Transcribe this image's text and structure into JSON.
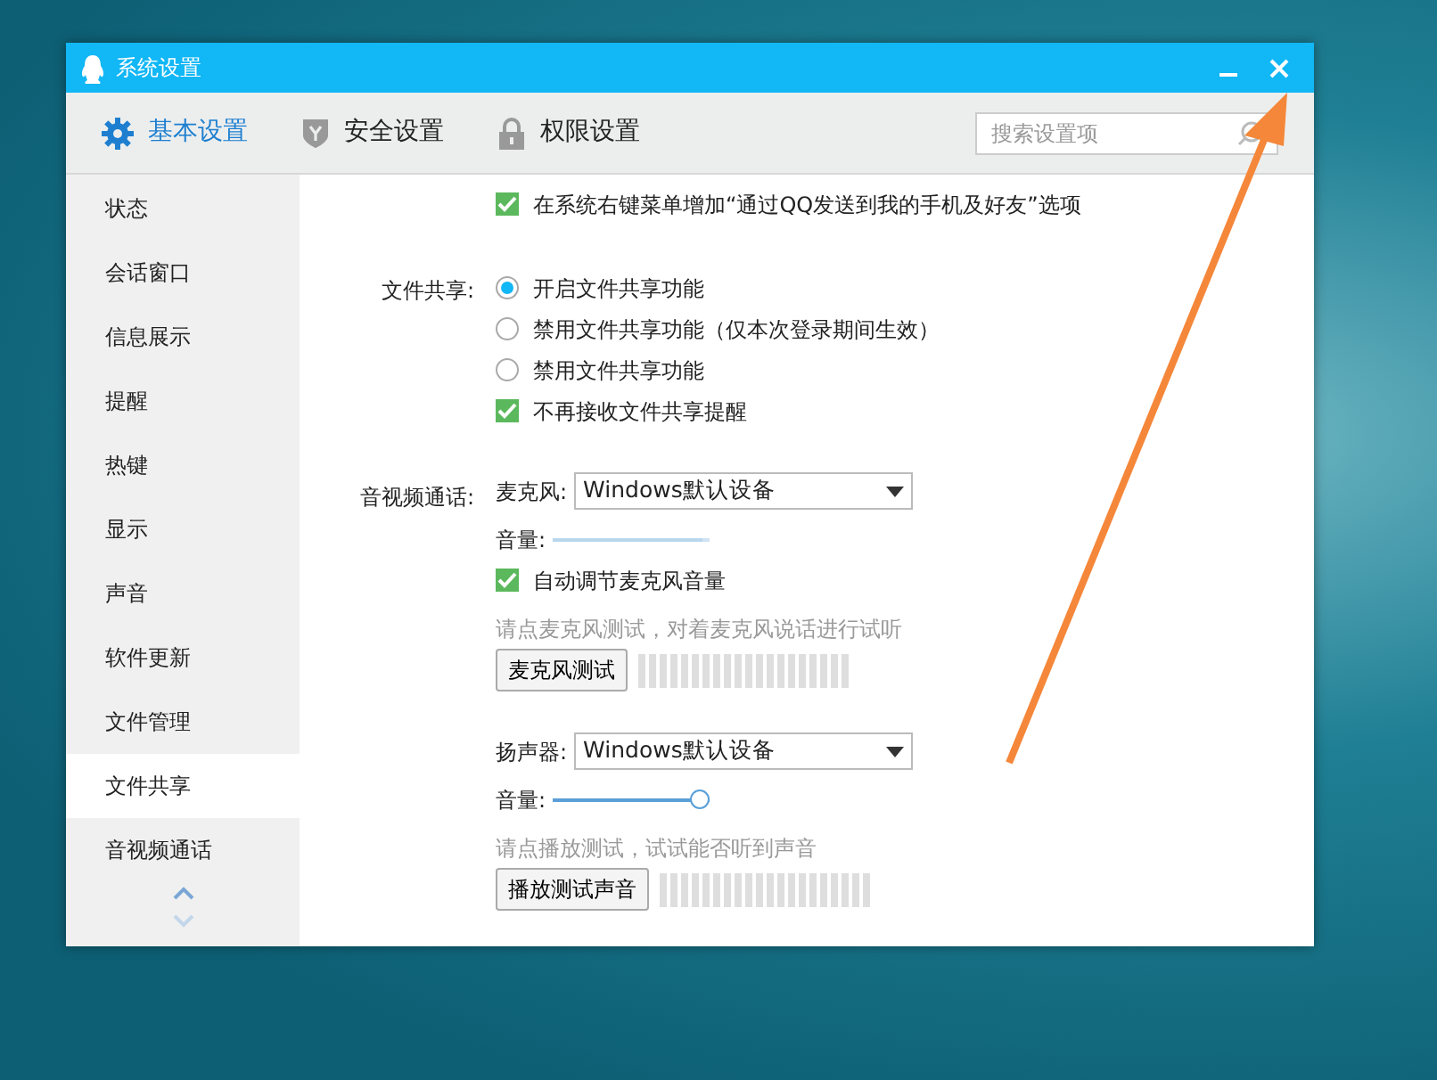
{
  "window": {
    "title": "系统设置"
  },
  "tabs": [
    {
      "label": "基本设置",
      "selected": true
    },
    {
      "label": "安全设置",
      "selected": false
    },
    {
      "label": "权限设置",
      "selected": false
    }
  ],
  "search": {
    "placeholder": "搜索设置项"
  },
  "sidebar": {
    "items": [
      {
        "label": "状态",
        "selected": false
      },
      {
        "label": "会话窗口",
        "selected": false
      },
      {
        "label": "信息展示",
        "selected": false
      },
      {
        "label": "提醒",
        "selected": false
      },
      {
        "label": "热键",
        "selected": false
      },
      {
        "label": "显示",
        "selected": false
      },
      {
        "label": "声音",
        "selected": false
      },
      {
        "label": "软件更新",
        "selected": false
      },
      {
        "label": "文件管理",
        "selected": false
      },
      {
        "label": "文件共享",
        "selected": true
      },
      {
        "label": "音视频通话",
        "selected": false
      }
    ]
  },
  "sections": [
    {
      "items": [
        {
          "kind": "checkbox",
          "label": "在系统右键菜单增加“通过QQ发送到我的手机及好友”选项",
          "checked": true
        }
      ]
    },
    {
      "label": "文件共享:",
      "items": [
        {
          "kind": "radio",
          "label": "开启文件共享功能",
          "selected": true
        },
        {
          "kind": "radio",
          "label": "禁用文件共享功能（仅本次登录期间生效）",
          "selected": false
        },
        {
          "kind": "radio",
          "label": "禁用文件共享功能",
          "selected": false
        },
        {
          "kind": "checkbox",
          "label": "不再接收文件共享提醒",
          "checked": true
        }
      ]
    },
    {
      "label": "音视频通话:",
      "items": [
        {
          "kind": "device",
          "label": "麦克风:",
          "value": "Windows默认设备"
        },
        {
          "kind": "slider",
          "label": "音量:",
          "level": 0.95,
          "disabled": true
        },
        {
          "kind": "checkbox",
          "label": "自动调节麦克风音量",
          "checked": true
        },
        {
          "kind": "hint",
          "text": "请点麦克风测试，对着麦克风说话进行试听"
        },
        {
          "kind": "test",
          "button": "麦克风测试"
        }
      ]
    },
    {
      "items": [
        {
          "kind": "device",
          "label": "扬声器:",
          "value": "Windows默认设备"
        },
        {
          "kind": "slider",
          "label": "音量:",
          "level": 1,
          "disabled": false
        },
        {
          "kind": "hint",
          "text": "请点播放测试，试试能否听到声音"
        },
        {
          "kind": "test",
          "button": "播放测试声音"
        }
      ]
    }
  ]
}
